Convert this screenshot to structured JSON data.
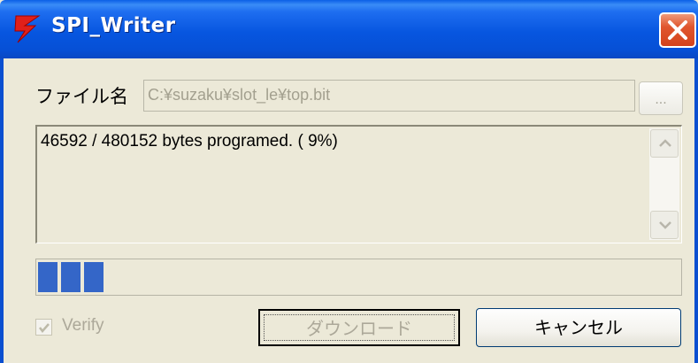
{
  "window": {
    "title": "SPI_Writer",
    "icon": "red-lightning-app-icon",
    "close": "close-icon"
  },
  "file": {
    "label": "ファイル名",
    "path": "C:¥suzaku¥slot_le¥top.bit",
    "browse_label": "..."
  },
  "log": {
    "text": "46592 / 480152 bytes programed. ( 9%)"
  },
  "progress": {
    "percent": 9
  },
  "options": {
    "verify_label": "Verify",
    "verify_checked": true
  },
  "buttons": {
    "download_label": "ダウンロード",
    "cancel_label": "キャンセル"
  },
  "colors": {
    "titlebar": "#0756e0",
    "close": "#d4431c",
    "progress": "#3466c8",
    "face": "#ece9d8"
  }
}
